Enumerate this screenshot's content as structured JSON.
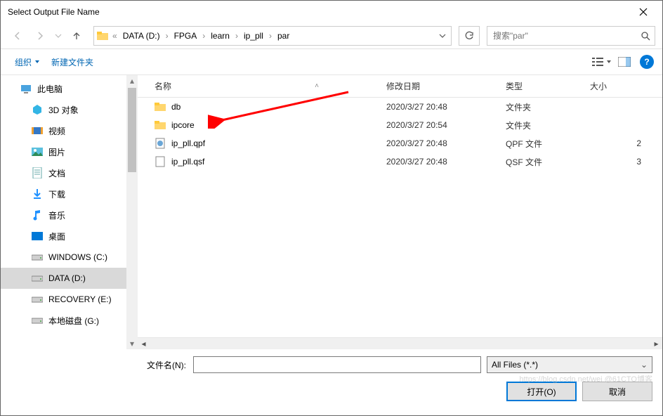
{
  "window": {
    "title": "Select Output File Name"
  },
  "breadcrumb": {
    "items": [
      "DATA (D:)",
      "FPGA",
      "learn",
      "ip_pll",
      "par"
    ]
  },
  "search": {
    "placeholder": "搜索\"par\""
  },
  "toolbar": {
    "organize": "组织",
    "newfolder": "新建文件夹"
  },
  "columns": {
    "name": "名称",
    "date": "修改日期",
    "type": "类型",
    "size": "大小"
  },
  "sidebar": {
    "items": [
      {
        "label": "此电脑",
        "icon": "pc"
      },
      {
        "label": "3D 对象",
        "icon": "3d",
        "sub": true
      },
      {
        "label": "视频",
        "icon": "video",
        "sub": true
      },
      {
        "label": "图片",
        "icon": "pic",
        "sub": true
      },
      {
        "label": "文档",
        "icon": "doc",
        "sub": true
      },
      {
        "label": "下载",
        "icon": "down",
        "sub": true
      },
      {
        "label": "音乐",
        "icon": "music",
        "sub": true
      },
      {
        "label": "桌面",
        "icon": "desk",
        "sub": true
      },
      {
        "label": "WINDOWS (C:)",
        "icon": "drive",
        "sub": true
      },
      {
        "label": "DATA (D:)",
        "icon": "drive",
        "sub": true,
        "selected": true
      },
      {
        "label": "RECOVERY (E:)",
        "icon": "drive",
        "sub": true
      },
      {
        "label": "本地磁盘 (G:)",
        "icon": "drive",
        "sub": true
      }
    ]
  },
  "files": [
    {
      "name": "db",
      "date": "2020/3/27 20:48",
      "type": "文件夹",
      "size": "",
      "icon": "folder"
    },
    {
      "name": "ipcore",
      "date": "2020/3/27 20:54",
      "type": "文件夹",
      "size": "",
      "icon": "folder"
    },
    {
      "name": "ip_pll.qpf",
      "date": "2020/3/27 20:48",
      "type": "QPF 文件",
      "size": "2",
      "icon": "qpf"
    },
    {
      "name": "ip_pll.qsf",
      "date": "2020/3/27 20:48",
      "type": "QSF 文件",
      "size": "3",
      "icon": "file"
    }
  ],
  "footer": {
    "filename_label": "文件名(N):",
    "filename_value": "",
    "filter": "All Files (*.*)",
    "open": "打开(O)",
    "cancel": "取消"
  },
  "watermark": "https://blog.csdn.net/wei @61CTO博客"
}
